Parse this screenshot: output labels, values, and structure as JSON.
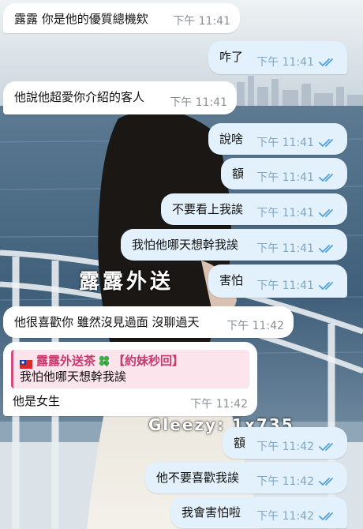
{
  "wallpaper": {
    "title": "露露外送",
    "watermark": "Gleezy: 1x735"
  },
  "colors": {
    "incoming_bubble": "#ffffff",
    "outgoing_bubble": "#e3f1fc",
    "read_check": "#4ea0e0",
    "reply_accent": "#d54c7e",
    "timestamp": "#8a8f96"
  },
  "messages": [
    {
      "direction": "incoming",
      "text": "露露 你是他的優質總機欸",
      "time": "下午 11:41"
    },
    {
      "direction": "outgoing",
      "text": "咋了",
      "time": "下午 11:41",
      "status": "read"
    },
    {
      "direction": "incoming",
      "text": "他說他超愛你介紹的客人",
      "time": "下午 11:41"
    },
    {
      "direction": "outgoing",
      "text": "說啥",
      "time": "下午 11:41",
      "status": "read"
    },
    {
      "direction": "outgoing",
      "text": "額",
      "time": "下午 11:41",
      "status": "read"
    },
    {
      "direction": "outgoing",
      "text": "不要看上我誒",
      "time": "下午 11:41",
      "status": "read"
    },
    {
      "direction": "outgoing",
      "text": "我怕他哪天想幹我誒",
      "time": "下午 11:41",
      "status": "read"
    },
    {
      "direction": "outgoing",
      "text": "害怕",
      "time": "下午 11:41",
      "status": "read"
    },
    {
      "direction": "incoming",
      "text": "他很喜歡你 雖然沒見過面 沒聊過天",
      "time": "下午 11:42"
    },
    {
      "direction": "incoming",
      "text": "他是女生",
      "time": "下午 11:42",
      "reply": {
        "sender": "露露外送茶",
        "sender_suffix": "【約妹秒回】",
        "flag_icon": "taiwan-flag-icon",
        "clover_icon": "four-leaf-clover-icon",
        "text": "我怕他哪天想幹我誒"
      }
    },
    {
      "direction": "outgoing",
      "text": "額",
      "time": "下午 11:42",
      "status": "read"
    },
    {
      "direction": "outgoing",
      "text": "他不要喜歡我誒",
      "time": "下午 11:42",
      "status": "read"
    },
    {
      "direction": "outgoing",
      "text": "我會害怕啦",
      "time": "下午 11:42",
      "status": "read"
    }
  ]
}
